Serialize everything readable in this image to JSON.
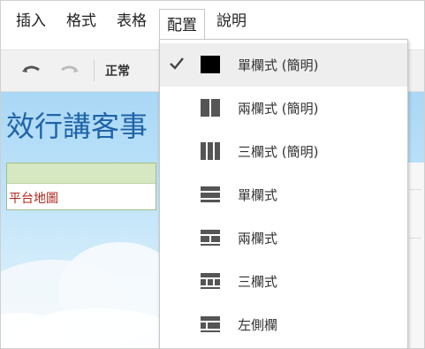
{
  "menubar": {
    "items": [
      "插入",
      "格式",
      "表格",
      "配置",
      "說明"
    ]
  },
  "toolbar": {
    "format_label": "正常"
  },
  "blog": {
    "title_fragment": "效行講客事",
    "nav_link": "平台地圖"
  },
  "layout_menu": {
    "items": [
      {
        "label": "單欄式 (簡明)",
        "icon": "single-column-simple-icon",
        "selected": true
      },
      {
        "label": "兩欄式 (簡明)",
        "icon": "two-column-simple-icon",
        "selected": false
      },
      {
        "label": "三欄式 (簡明)",
        "icon": "three-column-simple-icon",
        "selected": false
      },
      {
        "label": "單欄式",
        "icon": "single-column-icon",
        "selected": false
      },
      {
        "label": "兩欄式",
        "icon": "two-column-icon",
        "selected": false
      },
      {
        "label": "三欄式",
        "icon": "three-column-icon",
        "selected": false
      },
      {
        "label": "左側欄",
        "icon": "left-sidebar-icon",
        "selected": false
      }
    ]
  },
  "colors": {
    "title_blue": "#1f64a8",
    "link_red": "#b0261d",
    "icon_gray": "#555555",
    "icon_black": "#000000"
  }
}
